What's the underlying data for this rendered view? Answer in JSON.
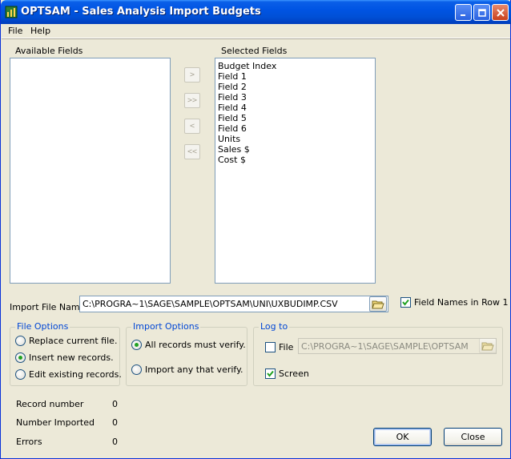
{
  "window": {
    "title": "OPTSAM - Sales Analysis Import Budgets",
    "title_colors": {
      "bar": "#0054e3",
      "text": "#ffffff"
    }
  },
  "menu": [
    {
      "label": "File"
    },
    {
      "label": "Help"
    }
  ],
  "available_fields": {
    "label": "Available Fields",
    "items": []
  },
  "selected_fields": {
    "label": "Selected Fields",
    "items": [
      "Budget Index",
      "Field 1",
      "Field 2",
      "Field 3",
      "Field 4",
      "Field 5",
      "Field 6",
      "Units",
      "Sales $",
      "Cost $"
    ]
  },
  "movers": {
    "add_one": ">",
    "add_all": ">>",
    "remove_one": "<",
    "remove_all": "<<"
  },
  "import_file": {
    "label": "Import File Name",
    "value": "C:\\PROGRA~1\\SAGE\\SAMPLE\\OPTSAM\\UNI\\UXBUDIMP.CSV",
    "browse_icon": "folder-open-icon"
  },
  "field_names_in_row1": {
    "label": "Field Names in Row 1",
    "checked": true
  },
  "file_options": {
    "title": "File Options",
    "options": [
      {
        "label": "Replace current file.",
        "selected": false
      },
      {
        "label": "Insert new records.",
        "selected": true
      },
      {
        "label": "Edit existing records.",
        "selected": false
      }
    ]
  },
  "import_options": {
    "title": "Import Options",
    "options": [
      {
        "label": "All records must verify.",
        "selected": true
      },
      {
        "label": "Import any that verify.",
        "selected": false
      }
    ]
  },
  "log_to": {
    "title": "Log to",
    "file": {
      "label": "File",
      "checked": false,
      "path": "C:\\PROGRA~1\\SAGE\\SAMPLE\\OPTSAM"
    },
    "screen": {
      "label": "Screen",
      "checked": true
    }
  },
  "stats": {
    "record_number": {
      "label": "Record number",
      "value": "0"
    },
    "number_imported": {
      "label": "Number Imported",
      "value": "0"
    },
    "errors": {
      "label": "Errors",
      "value": "0"
    }
  },
  "buttons": {
    "ok": "OK",
    "close": "Close"
  }
}
